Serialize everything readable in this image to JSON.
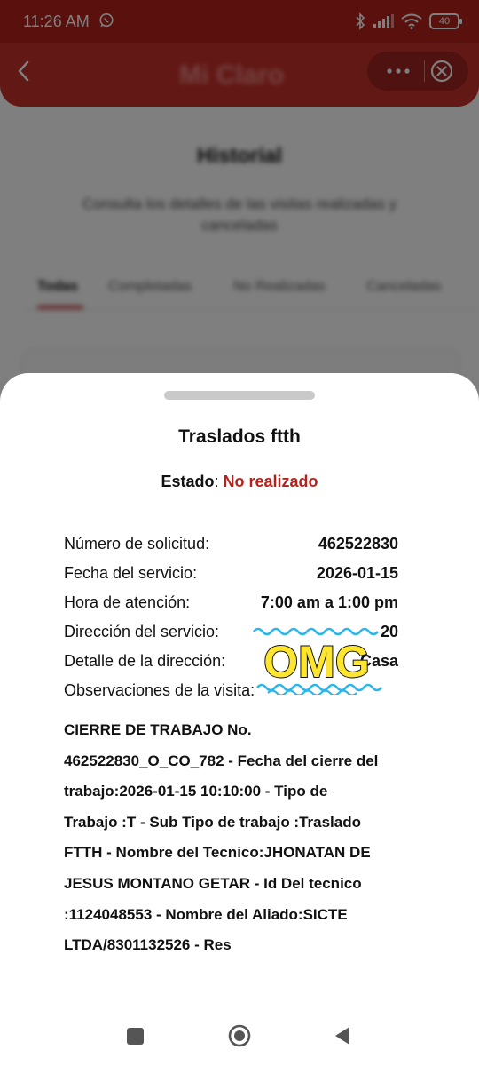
{
  "status_bar": {
    "time": "11:26 AM",
    "battery": "40"
  },
  "app_bar": {
    "logo": "Mi Claro"
  },
  "background": {
    "title": "Historial",
    "subtitle": "Consulta los detalles de las visitas realizadas y canceladas",
    "tabs": [
      "Todas",
      "Completadas",
      "No Realizadas",
      "Canceladas"
    ]
  },
  "sheet": {
    "title": "Traslados ftth",
    "estado_label": "Estado",
    "estado_value": "No realizado",
    "details": [
      {
        "label": "Número de solicitud:",
        "value": "462522830"
      },
      {
        "label": "Fecha del servicio:",
        "value": "2026-01-15"
      },
      {
        "label": "Hora de atención:",
        "value": "7:00 am a 1:00 pm"
      },
      {
        "label": "Dirección del servicio:",
        "value": "CR 3A # 10 - 20"
      },
      {
        "label": "Detalle de la dirección:",
        "value": "Casa"
      },
      {
        "label": "Observaciones de la visita:",
        "value": ""
      }
    ],
    "observations_lines": [
      "CIERRE DE TRABAJO No.",
      "462522830_O_CO_782 - Fecha del cierre del",
      "trabajo:2026-01-15 10:10:00 - Tipo de",
      "Trabajo :T - Sub Tipo de trabajo :Traslado",
      "FTTH - Nombre del Tecnico:JHONATAN DE",
      "JESUS MONTANO GETAR - Id Del tecnico",
      ":1124048553 - Nombre del Aliado:SICTE",
      "LTDA/8301132526 - Res"
    ],
    "sticker_text": "OMG"
  },
  "colors": {
    "brand_red": "#c5302a",
    "status_red": "#b5221c",
    "sticker_yellow": "#ffe62e",
    "sticker_blue": "#2bb5ea"
  }
}
